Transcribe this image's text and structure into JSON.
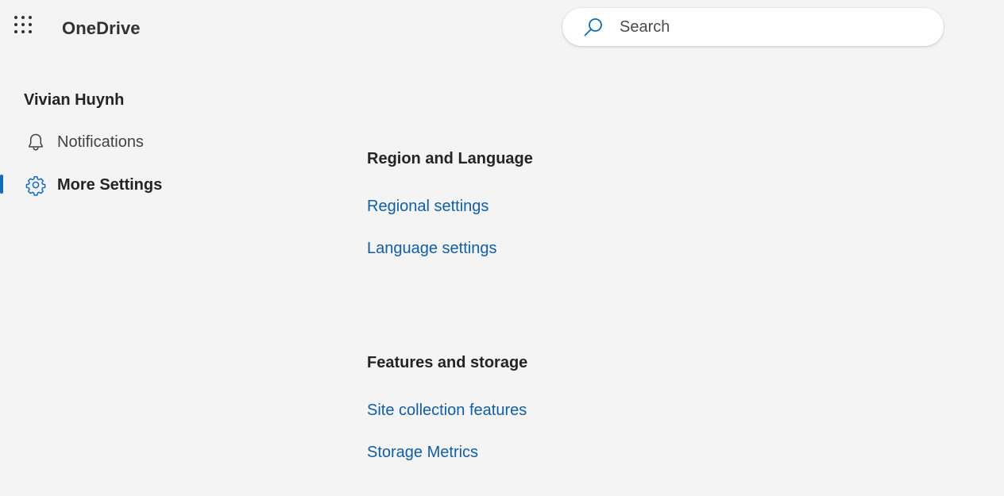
{
  "header": {
    "app_title": "OneDrive",
    "app_launcher_icon": "waffle-icon"
  },
  "search": {
    "placeholder": "Search",
    "value": "",
    "icon": "search-icon"
  },
  "sidebar": {
    "user_name": "Vivian Huynh",
    "items": [
      {
        "label": "Notifications",
        "icon": "bell-icon",
        "active": false
      },
      {
        "label": "More Settings",
        "icon": "gear-icon",
        "active": true
      }
    ]
  },
  "main": {
    "sections": [
      {
        "heading": "Region and Language",
        "links": [
          "Regional settings",
          "Language settings"
        ]
      },
      {
        "heading": "Features and storage",
        "links": [
          "Site collection features",
          "Storage Metrics"
        ]
      }
    ]
  },
  "colors": {
    "background": "#f4f4f4",
    "link": "#115ea3",
    "accent": "#0f6cbd",
    "text": "#242424"
  }
}
